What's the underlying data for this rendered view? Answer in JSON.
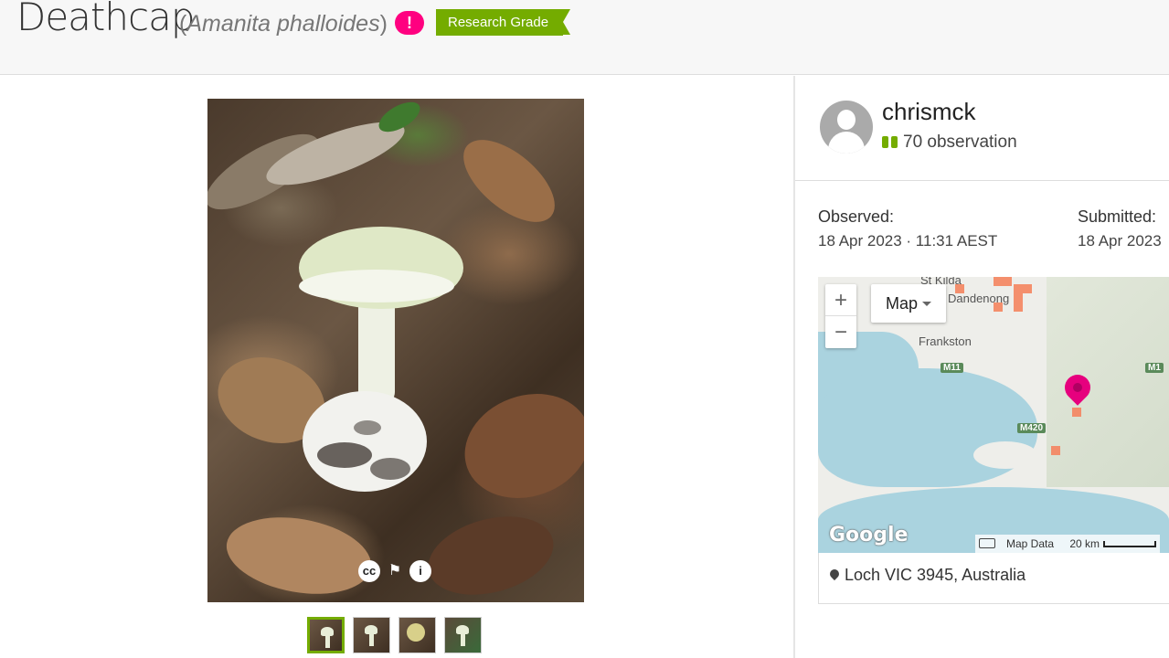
{
  "header": {
    "common_name": "Deathcap",
    "scientific_name_open": "(",
    "scientific_name": "Amanita phalloides",
    "scientific_name_close": ")",
    "alert_badge": "!",
    "quality_grade": "Research Grade"
  },
  "photo": {
    "thumbnails": [
      {
        "name": "thumb-1",
        "active": true
      },
      {
        "name": "thumb-2",
        "active": false
      },
      {
        "name": "thumb-3",
        "active": false
      },
      {
        "name": "thumb-4",
        "active": false
      }
    ],
    "icons": [
      "cc-license-icon",
      "flag-icon",
      "info-icon"
    ]
  },
  "user": {
    "username": "chrismck",
    "observation_count": "70 observation"
  },
  "dates": {
    "observed_label": "Observed:",
    "observed_value": "18 Apr 2023 · 11:31 AEST",
    "submitted_label": "Submitted:",
    "submitted_value": "18 Apr 2023"
  },
  "map": {
    "type_label": "Map",
    "zoom_in": "+",
    "zoom_out": "−",
    "place_labels": [
      "St Kilda",
      "Dandenong",
      "Frankston"
    ],
    "roads": [
      "M11",
      "M1",
      "M420"
    ],
    "logo": "Google",
    "map_data": "Map Data",
    "scale": "20 km"
  },
  "location": {
    "text": "Loch VIC 3945, Australia"
  },
  "colors": {
    "accent_green": "#74ac00",
    "alert_pink": "#ff0080",
    "pin_pink": "#e6007e"
  }
}
